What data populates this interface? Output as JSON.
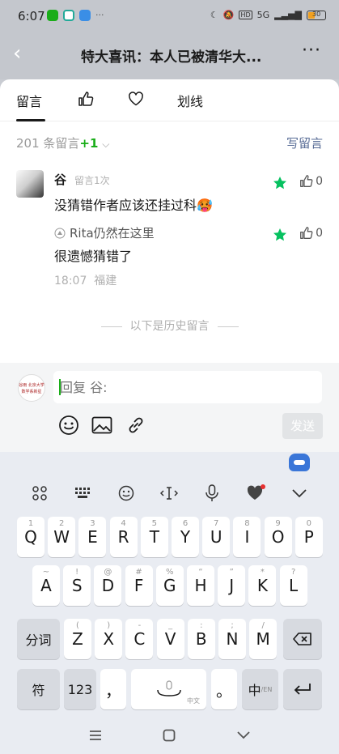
{
  "status_bar": {
    "time": "6:07",
    "network": "5G",
    "battery": "30"
  },
  "header": {
    "back_glyph": "‹",
    "title": "特大喜讯：本人已被清华大...",
    "more_glyph": "···"
  },
  "tabs": [
    {
      "label": "留言"
    },
    {
      "label": "划线"
    }
  ],
  "summary": {
    "count_text": "201 条留言",
    "plus_text": "+1",
    "write_label": "写留言"
  },
  "comments": [
    {
      "name": "谷",
      "meta": "留言1次",
      "text": "没猜错作者应该还挂过科🥵",
      "likes": "0",
      "reply": {
        "name": "Rita仍然在这里",
        "text": "很遗憾猜错了",
        "likes": "0"
      },
      "time": "18:07",
      "location": "福建"
    }
  ],
  "divider_text": "以下是历史留言",
  "reply_box": {
    "avatar_text": "谷雨 北京大学 数学系新星",
    "placeholder": "回复 谷:",
    "send_label": "发送"
  },
  "keyboard": {
    "row1": [
      {
        "k": "Q",
        "h": "1"
      },
      {
        "k": "W",
        "h": "2"
      },
      {
        "k": "E",
        "h": "3"
      },
      {
        "k": "R",
        "h": "4"
      },
      {
        "k": "T",
        "h": "5"
      },
      {
        "k": "Y",
        "h": "6"
      },
      {
        "k": "U",
        "h": "7"
      },
      {
        "k": "I",
        "h": "8"
      },
      {
        "k": "O",
        "h": "9"
      },
      {
        "k": "P",
        "h": "0"
      }
    ],
    "row2": [
      {
        "k": "A",
        "h": "~"
      },
      {
        "k": "S",
        "h": "!"
      },
      {
        "k": "D",
        "h": "@"
      },
      {
        "k": "F",
        "h": "#"
      },
      {
        "k": "G",
        "h": "%"
      },
      {
        "k": "H",
        "h": "“"
      },
      {
        "k": "J",
        "h": "”"
      },
      {
        "k": "K",
        "h": "*"
      },
      {
        "k": "L",
        "h": "?"
      }
    ],
    "row3": [
      {
        "k": "Z",
        "h": "("
      },
      {
        "k": "X",
        "h": ")"
      },
      {
        "k": "C",
        "h": "-"
      },
      {
        "k": "V",
        "h": "_"
      },
      {
        "k": "B",
        "h": ":"
      },
      {
        "k": "N",
        "h": ";"
      },
      {
        "k": "M",
        "h": "/"
      }
    ],
    "fenci": "分词",
    "fu": "符",
    "num": "123",
    "comma": "，",
    "period": "。",
    "space_sub": "中文",
    "lang": "中",
    "lang_sub": "/EN"
  }
}
